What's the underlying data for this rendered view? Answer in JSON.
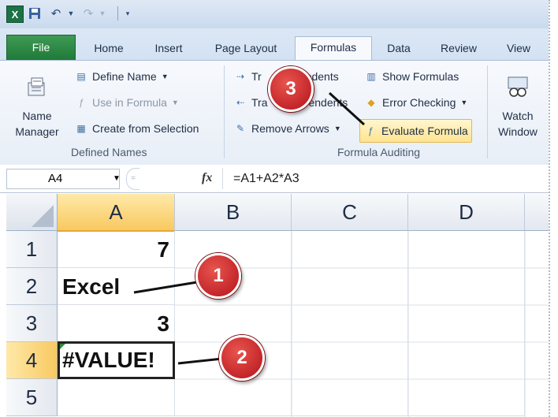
{
  "qat": {
    "logo": "X",
    "icons": [
      "excel-logo",
      "save-icon",
      "undo-icon",
      "redo-icon",
      "customize-dropdown"
    ]
  },
  "tabs": {
    "file": "File",
    "home": "Home",
    "insert": "Insert",
    "page_layout": "Page Layout",
    "formulas": "Formulas",
    "data": "Data",
    "review": "Review",
    "view": "View"
  },
  "ribbon": {
    "name_manager_line1": "Name",
    "name_manager_line2": "Manager",
    "define_name": "Define Name",
    "use_in_formula": "Use in Formula",
    "create_from_selection": "Create from Selection",
    "defined_names_label": "Defined Names",
    "trace_precedents_part": "Tr",
    "trace_precedents_tail": "edents",
    "trace_dependents_part": "Tra",
    "trace_dependents_tail": "endents",
    "remove_arrows": "Remove Arrows",
    "show_formulas": "Show Formulas",
    "error_checking": "Error Checking",
    "evaluate_formula": "Evaluate Formula",
    "formula_auditing_label": "Formula Auditing",
    "watch_window_line1": "Watch",
    "watch_window_line2": "Window"
  },
  "formula_bar": {
    "name_box": "A4",
    "fx": "fx",
    "formula": "=A1+A2*A3"
  },
  "grid": {
    "columns": [
      "A",
      "B",
      "C",
      "D"
    ],
    "rows": [
      "1",
      "2",
      "3",
      "4",
      "5"
    ],
    "cells": {
      "A1": "7",
      "A2": "Excel",
      "A3": "3",
      "A4": "#VALUE!"
    }
  },
  "callouts": {
    "one": "1",
    "two": "2",
    "three": "3",
    "color": "#c0161f"
  }
}
